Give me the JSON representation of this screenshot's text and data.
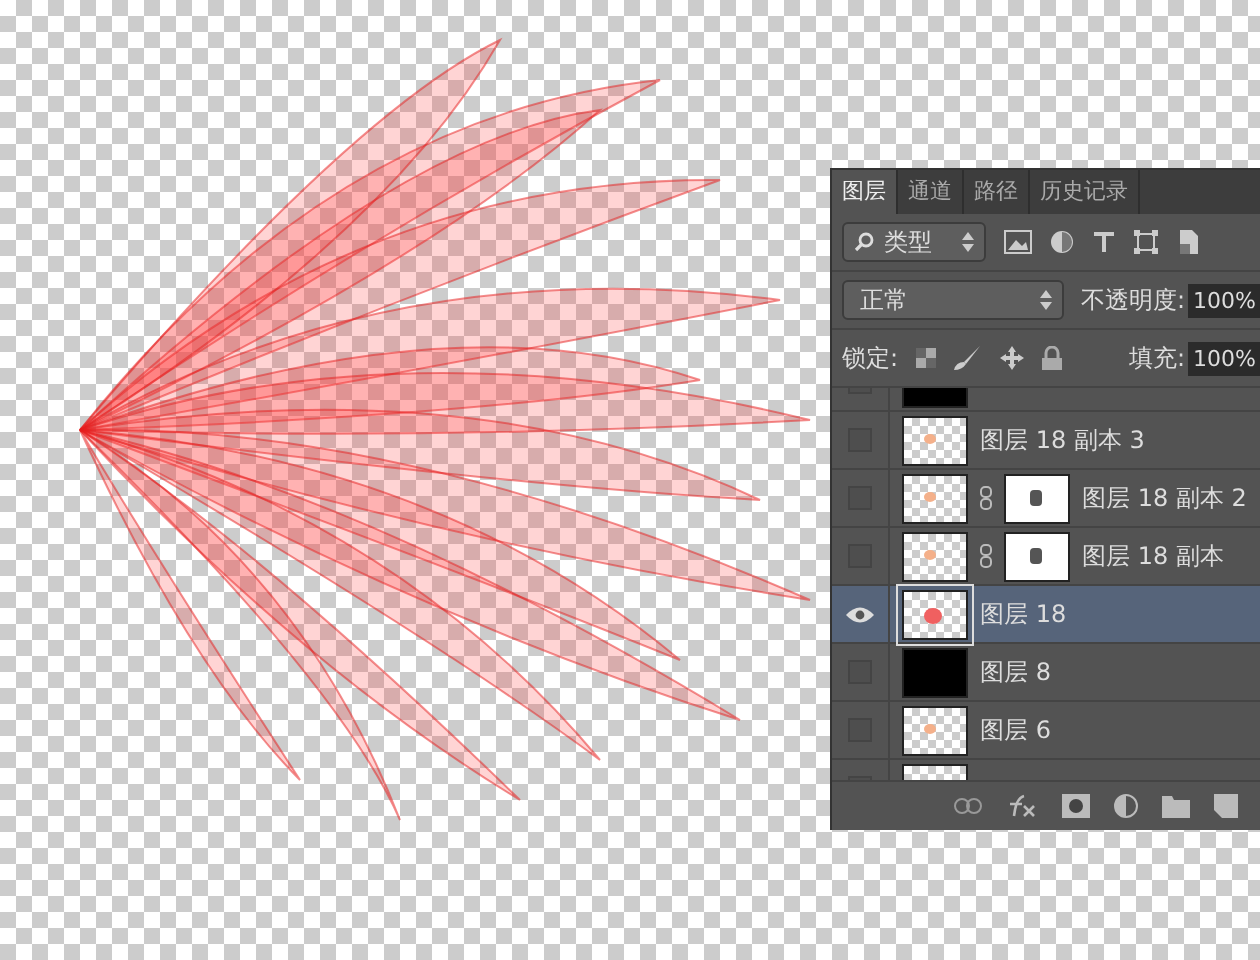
{
  "layers_panel": {
    "tabs": [
      {
        "label": "图层",
        "selected": true
      },
      {
        "label": "通道",
        "selected": false
      },
      {
        "label": "路径",
        "selected": false
      },
      {
        "label": "历史记录",
        "selected": false
      }
    ],
    "filter": {
      "value": "类型"
    },
    "blend_mode": {
      "value": "正常"
    },
    "opacity": {
      "label": "不透明度:",
      "value": "100%"
    },
    "lock": {
      "label": "锁定:"
    },
    "fill": {
      "label": "填充:",
      "value": "100%"
    },
    "layers": [
      {
        "kind": "black",
        "visible": false,
        "selected": false
      },
      {
        "kind": "transparent",
        "name": "图层 18 副本 3",
        "visible": false,
        "selected": false
      },
      {
        "kind": "masked",
        "name": "图层 18 副本 2",
        "visible": false,
        "selected": false
      },
      {
        "kind": "masked",
        "name": "图层 18 副本",
        "visible": false,
        "selected": false
      },
      {
        "kind": "petal",
        "name": "图层 18",
        "visible": true,
        "selected": true
      },
      {
        "kind": "black",
        "name": "图层 8",
        "visible": false,
        "selected": false
      },
      {
        "kind": "transparent",
        "name": "图层 6",
        "visible": false,
        "selected": false
      },
      {
        "kind": "transparent",
        "visible": false,
        "selected": false
      }
    ]
  }
}
